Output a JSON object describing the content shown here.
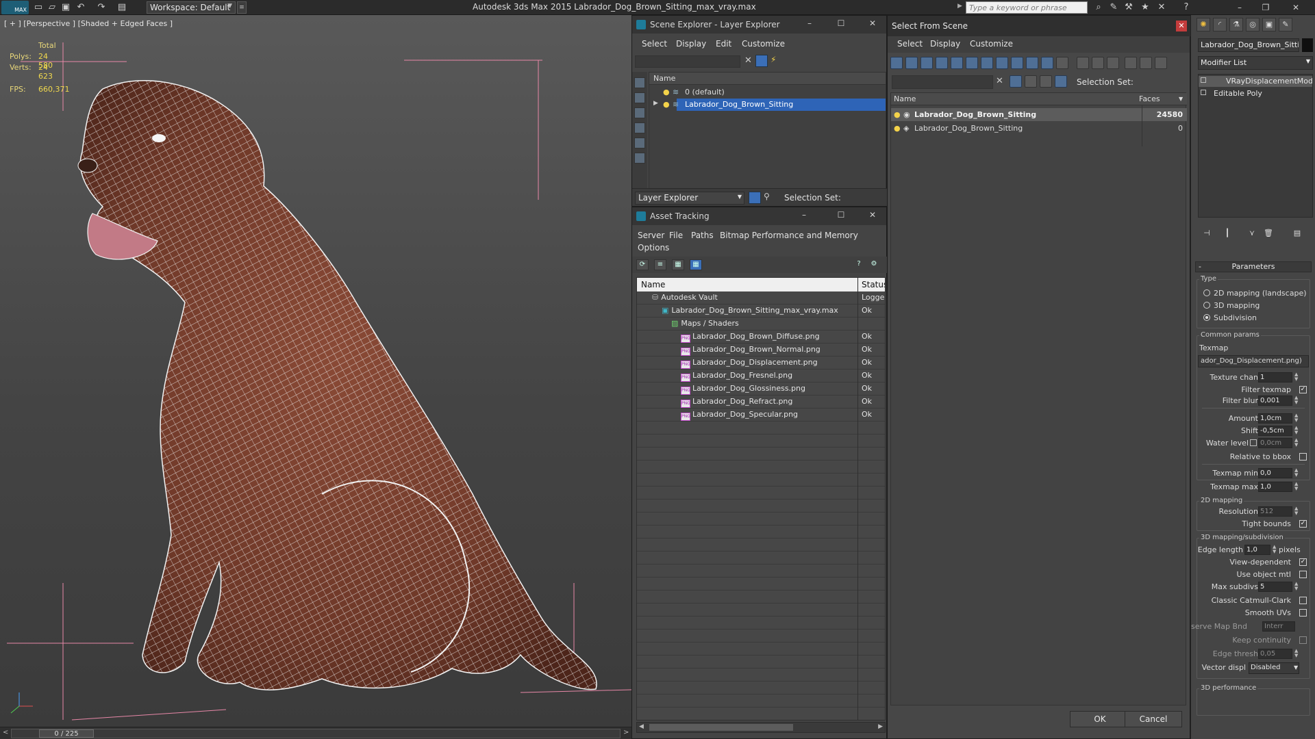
{
  "app": {
    "logo_text": "MAX",
    "workspace_label": "Workspace: Default",
    "title": "Autodesk 3ds Max  2015     Labrador_Dog_Brown_Sitting_max_vray.max",
    "search_placeholder": "Type a keyword or phrase"
  },
  "viewport": {
    "label": "[ + ] [Perspective ] [Shaded + Edged Faces ]",
    "stats": {
      "total_label": "Total",
      "polys_label": "Polys:",
      "polys_value": "24 580",
      "verts_label": "Verts:",
      "verts_value": "24 623",
      "fps_label": "FPS:",
      "fps_value": "660,371"
    },
    "time_slider": "0 / 225"
  },
  "scene_explorer": {
    "title": "Scene Explorer - Layer Explorer",
    "menu": [
      "Select",
      "Display",
      "Edit",
      "Customize"
    ],
    "column_name": "Name",
    "layers": [
      {
        "name": "0 (default)",
        "selected": false
      },
      {
        "name": "Labrador_Dog_Brown_Sitting",
        "selected": true
      }
    ],
    "footer_dropdown": "Layer Explorer",
    "selection_set_label": "Selection Set:"
  },
  "asset_tracking": {
    "title": "Asset Tracking",
    "menu": [
      "Server",
      "File",
      "Paths",
      "Bitmap Performance and Memory"
    ],
    "menu_row2": "Options",
    "columns": [
      "Name",
      "Status"
    ],
    "rows": [
      {
        "name": "Autodesk Vault",
        "status": "Logged",
        "indent": 1,
        "icon": "vault"
      },
      {
        "name": "Labrador_Dog_Brown_Sitting_max_vray.max",
        "status": "Ok",
        "indent": 2,
        "icon": "max"
      },
      {
        "name": "Maps / Shaders",
        "status": "",
        "indent": 3,
        "icon": "maps"
      },
      {
        "name": "Labrador_Dog_Brown_Diffuse.png",
        "status": "Ok",
        "indent": 4,
        "icon": "png"
      },
      {
        "name": "Labrador_Dog_Brown_Normal.png",
        "status": "Ok",
        "indent": 4,
        "icon": "png"
      },
      {
        "name": "Labrador_Dog_Displacement.png",
        "status": "Ok",
        "indent": 4,
        "icon": "png"
      },
      {
        "name": "Labrador_Dog_Fresnel.png",
        "status": "Ok",
        "indent": 4,
        "icon": "png"
      },
      {
        "name": "Labrador_Dog_Glossiness.png",
        "status": "Ok",
        "indent": 4,
        "icon": "png"
      },
      {
        "name": "Labrador_Dog_Refract.png",
        "status": "Ok",
        "indent": 4,
        "icon": "png"
      },
      {
        "name": "Labrador_Dog_Specular.png",
        "status": "Ok",
        "indent": 4,
        "icon": "png"
      }
    ]
  },
  "select_from_scene": {
    "title": "Select From Scene",
    "menu": [
      "Select",
      "Display",
      "Customize"
    ],
    "selection_set_label": "Selection Set:",
    "columns": [
      "Name",
      "Faces"
    ],
    "rows": [
      {
        "name": "Labrador_Dog_Brown_Sitting",
        "faces": "24580",
        "highlight": true
      },
      {
        "name": "Labrador_Dog_Brown_Sitting",
        "faces": "0",
        "highlight": false
      }
    ],
    "ok_label": "OK",
    "cancel_label": "Cancel"
  },
  "command_panel": {
    "object_name": "Labrador_Dog_Brown_Sitting",
    "modifier_list": "Modifier List",
    "stack": [
      "VRayDisplacementMod",
      "Editable Poly"
    ],
    "parameters_title": "Parameters",
    "type_group": "Type",
    "type_options": [
      {
        "label": "2D mapping (landscape)",
        "on": false
      },
      {
        "label": "3D mapping",
        "on": false
      },
      {
        "label": "Subdivision",
        "on": true
      }
    ],
    "common_group": "Common params",
    "texmap_label": "Texmap",
    "texmap_value": "ador_Dog_Displacement.png)",
    "params": {
      "texture_chan_label": "Texture chan",
      "texture_chan": "1",
      "filter_texmap_label": "Filter texmap",
      "filter_blur_label": "Filter blur",
      "filter_blur": "0,001",
      "amount_label": "Amount",
      "amount": "1,0cm",
      "shift_label": "Shift",
      "shift": "-0,5cm",
      "water_level_label": "Water level",
      "water_level": "0,0cm",
      "relative_bbox_label": "Relative to bbox",
      "texmap_min_label": "Texmap min",
      "texmap_min": "0,0",
      "texmap_max_label": "Texmap max",
      "texmap_max": "1,0"
    },
    "mapping2d_group": "2D mapping",
    "resolution_label": "Resolution",
    "resolution": "512",
    "tight_bounds_label": "Tight bounds",
    "subdiv_group": "3D mapping/subdivision",
    "edge_length_label": "Edge length",
    "edge_length": "1,0",
    "pixels_label": "pixels",
    "view_dependent_label": "View-dependent",
    "use_object_mtl_label": "Use object mtl",
    "max_subdivs_label": "Max subdivs",
    "max_subdivs": "5",
    "classic_cc_label": "Classic Catmull-Clark",
    "smooth_uvs_label": "Smooth UVs",
    "preserve_map_label": "Preserve Map Bnd",
    "preserve_map_value": "Interr",
    "keep_continuity_label": "Keep continuity",
    "edge_thresh_label": "Edge thresh",
    "edge_thresh": "0,05",
    "vector_displ_label": "Vector displ",
    "vector_displ_value": "Disabled",
    "performance_group": "3D performance"
  },
  "colors": {
    "wire": "#f3f3f3",
    "dog_skin": "#7a4030",
    "selection_blue": "#2e64b7",
    "stats_yellow": "#f1d94d",
    "grid_pink": "#e888a8"
  }
}
